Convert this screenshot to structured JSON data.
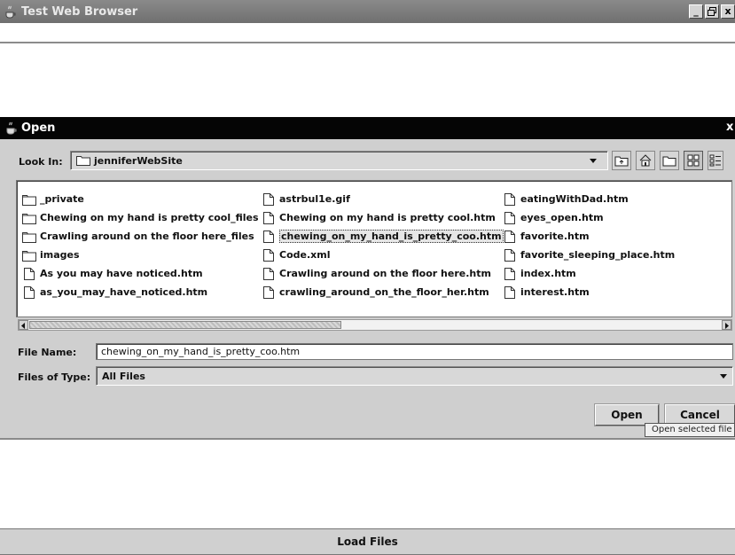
{
  "window": {
    "title": "Test Web Browser",
    "min_label": "_",
    "max_label": "᷵",
    "close_label": "x"
  },
  "dialog": {
    "title": "Open",
    "close_label": "x",
    "look_in_label": "Look In:",
    "look_in_value": "jenniferWebSite",
    "file_name_label": "File Name:",
    "file_name_value": "chewing_on_my_hand_is_pretty_coo.htm",
    "files_of_type_label": "Files of Type:",
    "files_of_type_value": "All Files",
    "open_label": "Open",
    "cancel_label": "Cancel",
    "tooltip": "Open selected file"
  },
  "files": {
    "col1": [
      {
        "name": "_private",
        "type": "folder"
      },
      {
        "name": "Chewing on my hand is pretty cool_files",
        "type": "folder"
      },
      {
        "name": "Crawling around on the floor here_files",
        "type": "folder"
      },
      {
        "name": "images",
        "type": "folder"
      },
      {
        "name": "As you may have noticed.htm",
        "type": "file"
      },
      {
        "name": "as_you_may_have_noticed.htm",
        "type": "file"
      }
    ],
    "col2": [
      {
        "name": "astrbul1e.gif",
        "type": "file"
      },
      {
        "name": "Chewing on my hand is pretty cool.htm",
        "type": "file"
      },
      {
        "name": "chewing_on_my_hand_is_pretty_coo.htm",
        "type": "file",
        "selected": true
      },
      {
        "name": "Code.xml",
        "type": "file"
      },
      {
        "name": "Crawling around on the floor here.htm",
        "type": "file"
      },
      {
        "name": "crawling_around_on_the_floor_her.htm",
        "type": "file"
      }
    ],
    "col3": [
      {
        "name": "eatingWithDad.htm",
        "type": "file"
      },
      {
        "name": "eyes_open.htm",
        "type": "file"
      },
      {
        "name": "favorite.htm",
        "type": "file"
      },
      {
        "name": "favorite_sleeping_place.htm",
        "type": "file"
      },
      {
        "name": "index.htm",
        "type": "file"
      },
      {
        "name": "interest.htm",
        "type": "file"
      }
    ]
  },
  "footer": {
    "load_label": "Load Files"
  }
}
